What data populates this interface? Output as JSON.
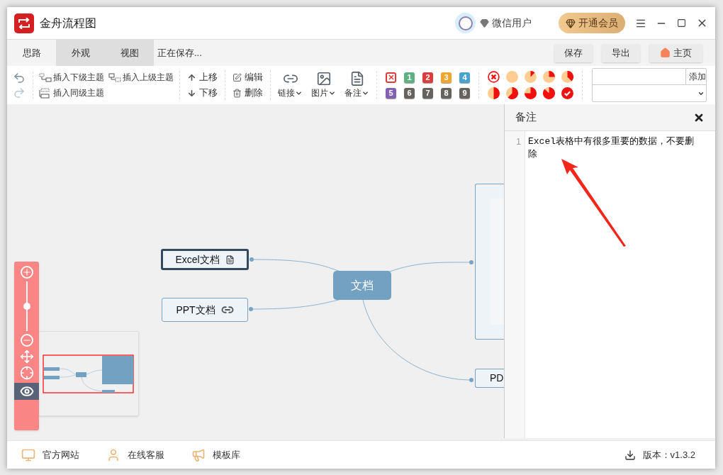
{
  "window": {
    "title": "金舟流程图"
  },
  "user": {
    "name": "微信用户"
  },
  "vip_button": "开通会员",
  "tabs": [
    {
      "label": "思路",
      "selected": true
    },
    {
      "label": "外观",
      "selected": false
    },
    {
      "label": "视图",
      "selected": false
    }
  ],
  "save_status": "正在保存...",
  "actions": [
    {
      "label": "保存",
      "kind": "plain"
    },
    {
      "label": "导出",
      "kind": "plain"
    },
    {
      "label": "主页",
      "kind": "home"
    }
  ],
  "toolbar": {
    "insert": [
      {
        "label": "插入下级主题",
        "kind": "child"
      },
      {
        "label": "插入上级主题",
        "kind": "parent"
      },
      {
        "label": "插入同级主题",
        "kind": "sibling"
      }
    ],
    "move": [
      {
        "label": "上移",
        "kind": "up"
      },
      {
        "label": "下移",
        "kind": "down"
      }
    ],
    "edit": [
      {
        "label": "编辑",
        "kind": "edit"
      },
      {
        "label": "删除",
        "kind": "delete"
      }
    ],
    "dropdowns": [
      {
        "label": "链接",
        "kind": "link"
      },
      {
        "label": "图片",
        "kind": "image"
      },
      {
        "label": "备注",
        "kind": "note"
      }
    ],
    "priorities": [
      {
        "kind": "clear"
      },
      {
        "kind": "number",
        "label": "1",
        "color": "#5fb184"
      },
      {
        "kind": "number",
        "label": "2",
        "color": "#dd3c3c"
      },
      {
        "kind": "number",
        "label": "3",
        "color": "#f0a52c"
      },
      {
        "kind": "number",
        "label": "4",
        "color": "#4aa3cf"
      },
      {
        "kind": "number",
        "label": "5",
        "color": "#8460b3"
      },
      {
        "kind": "number",
        "label": "6",
        "color": "#66625e"
      },
      {
        "kind": "number",
        "label": "7",
        "color": "#66625e"
      },
      {
        "kind": "number",
        "label": "8",
        "color": "#66625e"
      },
      {
        "kind": "number",
        "label": "9",
        "color": "#66625e"
      }
    ],
    "progress": [
      {
        "kind": "clear"
      },
      {
        "kind": "empty"
      },
      {
        "kind": "eighth"
      },
      {
        "kind": "quarter"
      },
      {
        "kind": "threeeighths"
      },
      {
        "kind": "half"
      },
      {
        "kind": "fiveeighths"
      },
      {
        "kind": "threequarters"
      },
      {
        "kind": "seveneighths"
      },
      {
        "kind": "done"
      }
    ],
    "tag_button": "添加"
  },
  "canvas": {
    "nodes": [
      {
        "kind": "central",
        "label": "文档",
        "selected": false
      },
      {
        "kind": "note",
        "label": "Excel文档",
        "selected": true
      },
      {
        "kind": "link",
        "label": "PPT文档",
        "selected": false
      },
      {
        "kind": "image",
        "selected": false
      },
      {
        "kind": "topic",
        "label": "PD",
        "selected": false
      }
    ],
    "zoom": {
      "level": 0.5
    },
    "preview_on": true
  },
  "note_panel": {
    "title": "备注",
    "lines": [
      {
        "number": "1",
        "text": "Excel表格中有很多重要的数据，不要删除"
      }
    ]
  },
  "footer": {
    "links": [
      {
        "label": "官方网站",
        "kind": "site"
      },
      {
        "label": "在线客服",
        "kind": "service"
      },
      {
        "label": "模板库",
        "kind": "templates"
      }
    ],
    "version": "版本：v1.3.2"
  }
}
